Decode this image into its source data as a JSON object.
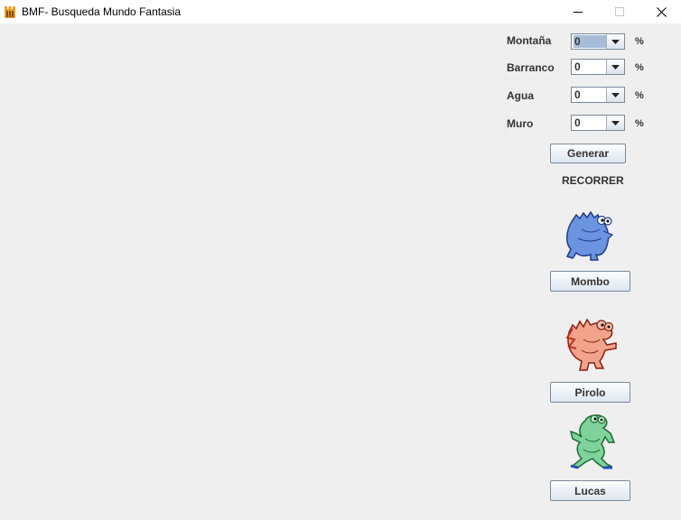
{
  "window": {
    "title": "BMF- Busqueda Mundo Fantasia",
    "minimize_symbol": "—",
    "close_symbol": "✕",
    "icon": "castle-icon"
  },
  "options": [
    {
      "label": "Montaña",
      "value": "0",
      "unit": "%"
    },
    {
      "label": "Barranco",
      "value": "0",
      "unit": "%"
    },
    {
      "label": "Agua",
      "value": "0",
      "unit": "%"
    },
    {
      "label": "Muro",
      "value": "0",
      "unit": "%"
    }
  ],
  "generate_label": "Generar",
  "recorrer_label": "RECORRER",
  "characters": [
    {
      "name": "Mombo",
      "color": "#4a7bd6",
      "icon": "blue-monster-icon"
    },
    {
      "name": "Pirolo",
      "color": "#e06040",
      "icon": "red-monster-icon"
    },
    {
      "name": "Lucas",
      "color": "#3cb060",
      "icon": "green-monster-icon"
    }
  ]
}
